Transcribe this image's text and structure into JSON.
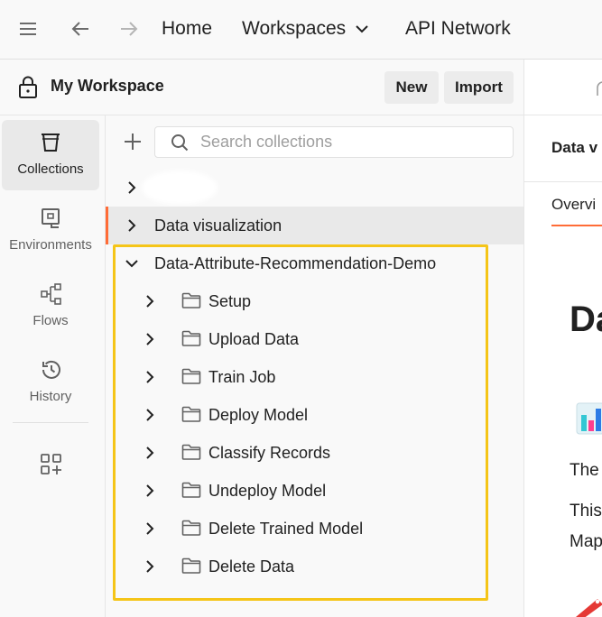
{
  "topbar": {
    "home": "Home",
    "workspaces": "Workspaces",
    "api_network": "API Network"
  },
  "workspace": {
    "title": "My Workspace",
    "new_label": "New",
    "import_label": "Import"
  },
  "rail": {
    "items": [
      {
        "label": "Collections",
        "icon": "collections-icon",
        "active": true
      },
      {
        "label": "Environments",
        "icon": "environments-icon",
        "active": false
      },
      {
        "label": "Flows",
        "icon": "flows-icon",
        "active": false
      },
      {
        "label": "History",
        "icon": "history-icon",
        "active": false
      }
    ]
  },
  "collections": {
    "search_placeholder": "Search collections",
    "items": [
      {
        "label": "Data visualization",
        "expanded": false
      },
      {
        "label": "Data-Attribute-Recommendation-Demo",
        "expanded": true
      }
    ],
    "folders": [
      "Setup",
      "Upload Data",
      "Train Job",
      "Deploy Model",
      "Classify Records",
      "Undeploy Model",
      "Delete Trained Model",
      "Delete Data"
    ]
  },
  "right_panel": {
    "tab_title": "Data v",
    "overview_tab": "Overvi",
    "heading": "Da",
    "para1": "The",
    "para2_line1": "This",
    "para2_line2": "Map"
  },
  "colors": {
    "accent": "#ff6c37",
    "highlight": "#f5c518",
    "selected_bg": "#e9e9e9"
  }
}
